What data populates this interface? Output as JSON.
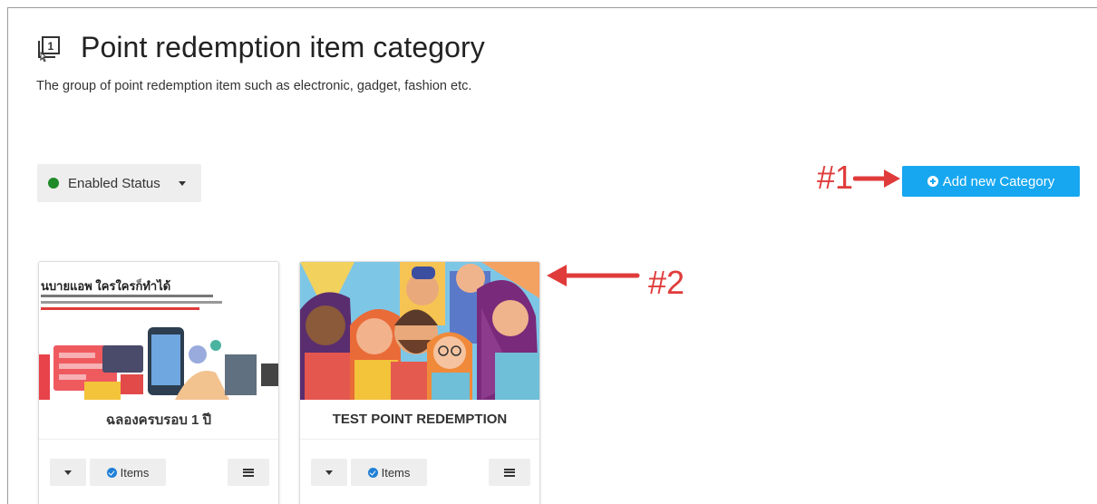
{
  "page": {
    "title": "Point redemption item category",
    "subtitle": "The group of point redemption item such as electronic, gadget, fashion etc."
  },
  "filter": {
    "status_label": "Enabled Status",
    "status_color": "#1e8a28"
  },
  "actions": {
    "add_label": "Add new Category",
    "add_color": "#17a7f0"
  },
  "annotations": {
    "first": "#1",
    "second": "#2",
    "color": "#e03b3b"
  },
  "categories": [
    {
      "name": "ฉลองครบรอบ 1 ปี",
      "thumb_headline": "นบายแอพ ใครใครก็ทำได้",
      "items_label": "Items",
      "menu_icon": "hamburger-icon"
    },
    {
      "name": "TEST POINT REDEMPTION",
      "items_label": "Items",
      "menu_icon": "hamburger-icon"
    }
  ]
}
